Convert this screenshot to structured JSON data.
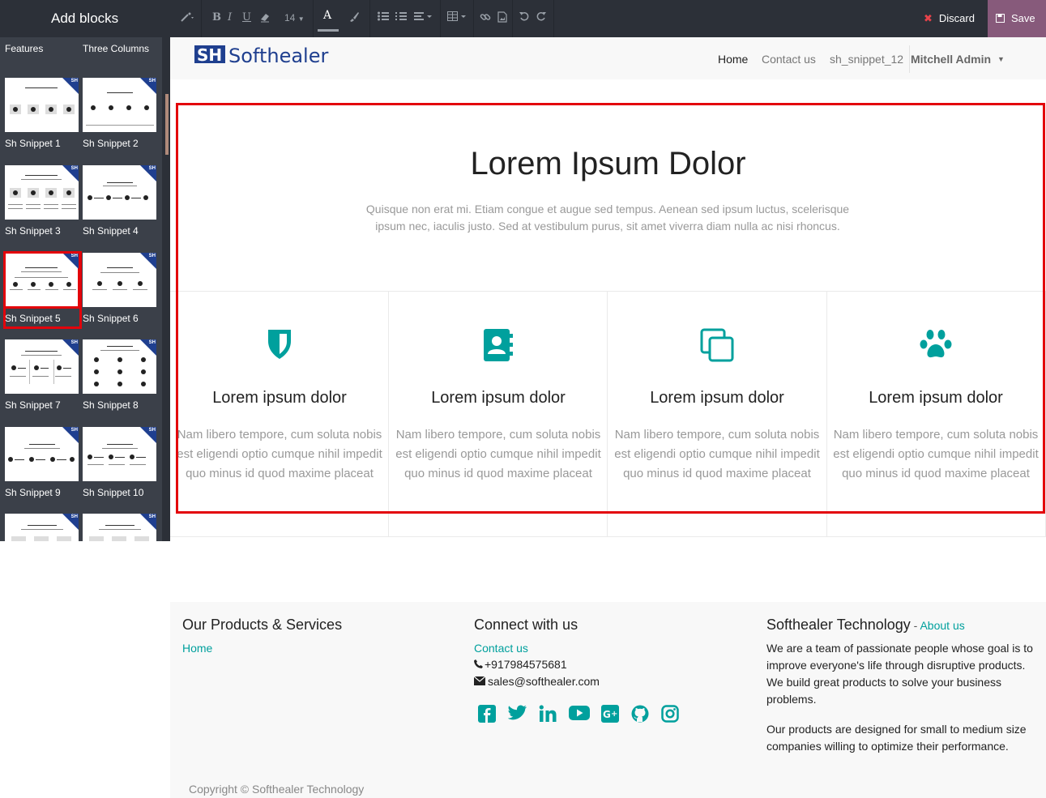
{
  "sidebar": {
    "title": "Add blocks",
    "snippets": [
      {
        "label": "Features"
      },
      {
        "label": "Three Columns"
      },
      {
        "label": "Sh Snippet 1"
      },
      {
        "label": "Sh Snippet 2"
      },
      {
        "label": "Sh Snippet 3"
      },
      {
        "label": "Sh Snippet 4"
      },
      {
        "label": "Sh Snippet 5",
        "selected": true
      },
      {
        "label": "Sh Snippet 6"
      },
      {
        "label": "Sh Snippet 7"
      },
      {
        "label": "Sh Snippet 8"
      },
      {
        "label": "Sh Snippet 9"
      },
      {
        "label": "Sh Snippet 10"
      },
      {
        "label": ""
      },
      {
        "label": ""
      }
    ],
    "badge": "SH"
  },
  "toolbar": {
    "font_size": "14",
    "discard_label": "Discard",
    "save_label": "Save",
    "icons": [
      "magic-icon",
      "bold-icon",
      "italic-icon",
      "underline-icon",
      "eraser-icon",
      "font-size-dropdown",
      "font-color-icon",
      "paint-brush-icon",
      "bullet-list-icon",
      "numbered-list-icon",
      "align-icon",
      "table-icon",
      "link-icon",
      "image-icon",
      "undo-icon",
      "redo-icon"
    ]
  },
  "navbar": {
    "logo_sh": "SH",
    "logo_text": "Softhealer",
    "links": [
      {
        "label": "Home",
        "active": true
      },
      {
        "label": "Contact us",
        "active": false
      },
      {
        "label": "sh_snippet_12",
        "active": false
      }
    ],
    "user": "Mitchell Admin"
  },
  "snippet": {
    "headline": "Lorem Ipsum Dolor",
    "subtext": "Quisque non erat mi. Etiam congue et augue sed tempus. Aenean sed ipsum luctus, scelerisque ipsum nec, iaculis justo. Sed at vestibulum purus, sit amet viverra diam nulla ac nisi rhoncus.",
    "features": [
      {
        "icon": "shield-icon",
        "title": "Lorem ipsum dolor",
        "desc": "Nam libero tempore, cum soluta nobis est eligendi optio cumque nihil impedit quo minus id quod maxime placeat"
      },
      {
        "icon": "address-book-icon",
        "title": "Lorem ipsum dolor",
        "desc": "Nam libero tempore, cum soluta nobis est eligendi optio cumque nihil impedit quo minus id quod maxime placeat"
      },
      {
        "icon": "clone-icon",
        "title": "Lorem ipsum dolor",
        "desc": "Nam libero tempore, cum soluta nobis est eligendi optio cumque nihil impedit quo minus id quod maxime placeat"
      },
      {
        "icon": "paw-icon",
        "title": "Lorem ipsum dolor",
        "desc": "Nam libero tempore, cum soluta nobis est eligendi optio cumque nihil impedit quo minus id quod maxime placeat"
      }
    ],
    "accent": "#00a09d"
  },
  "footer": {
    "col1": {
      "heading": "Our Products & Services",
      "link": "Home"
    },
    "col2": {
      "heading": "Connect with us",
      "link": "Contact us",
      "phone": "+917984575681",
      "email": "sales@softhealer.com",
      "social": [
        "facebook-icon",
        "twitter-icon",
        "linkedin-icon",
        "youtube-icon",
        "google-plus-icon",
        "github-icon",
        "instagram-icon"
      ]
    },
    "col3": {
      "heading": "Softhealer Technology",
      "heading_sep": " - ",
      "about_link": "About us",
      "para1": "We are a team of passionate people whose goal is to improve everyone's life through disruptive products. We build great products to solve your business problems.",
      "para2": "Our products are designed for small to medium size companies willing to optimize their performance."
    },
    "copyright": "Copyright © Softhealer Technology"
  }
}
